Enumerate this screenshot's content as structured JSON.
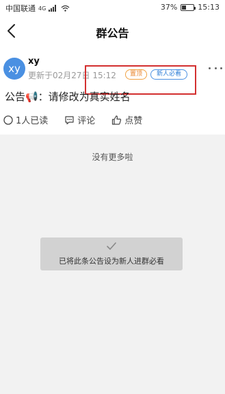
{
  "status_bar": {
    "carrier": "中国联通",
    "network": "4G",
    "battery": "37%",
    "time": "15:13"
  },
  "nav": {
    "title": "群公告"
  },
  "post": {
    "avatar_text": "xy",
    "author": "xy",
    "updated": "更新于02月27日 15:12",
    "badges": {
      "pinned": "置顶",
      "must_read": "新人必看"
    },
    "content": "公告📢：请修改为真实姓名",
    "actions": {
      "read": "1人已读",
      "comment": "评论",
      "like": "点赞"
    }
  },
  "list": {
    "no_more": "没有更多啦"
  },
  "toast": {
    "text": "已将此条公告设为新人进群必看"
  },
  "colors": {
    "avatar": "#4a90e2",
    "pinned_badge": "#e8832a",
    "must_read_badge": "#2f7fd8",
    "highlight": "#d32f2f"
  }
}
